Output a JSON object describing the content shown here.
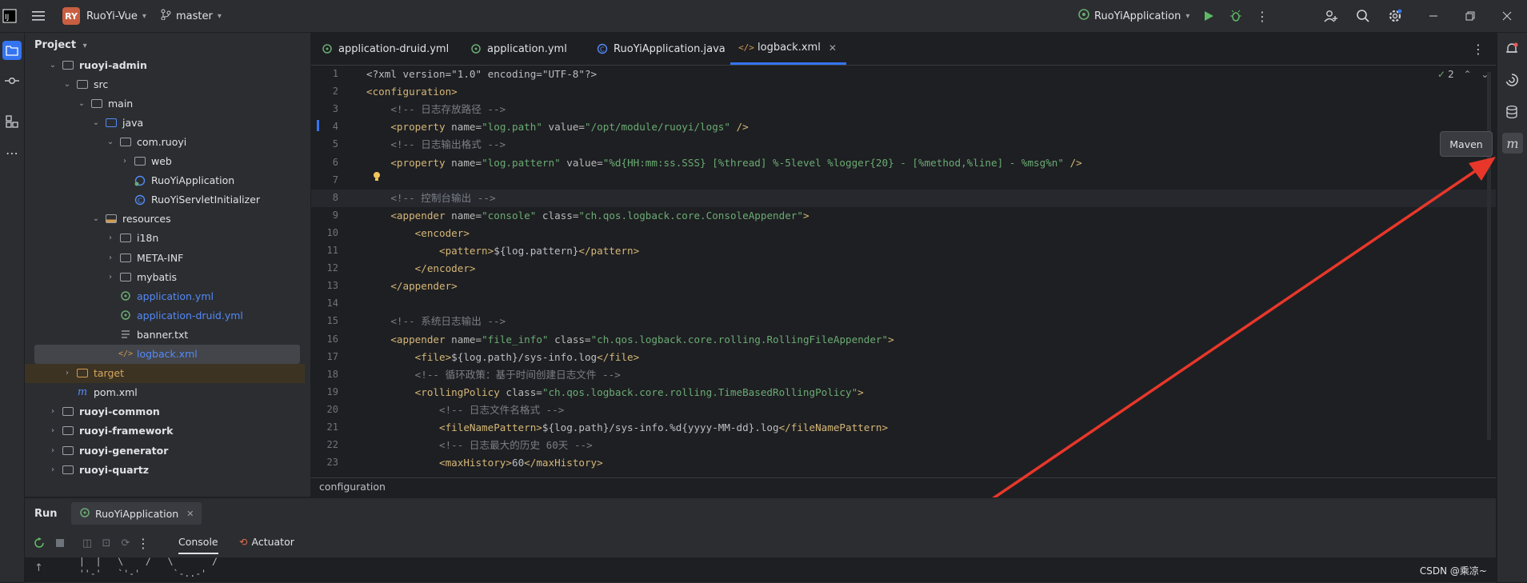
{
  "titlebar": {
    "project_badge": "RY",
    "project_name": "RuoYi-Vue",
    "branch": "master",
    "run_config": "RuoYiApplication",
    "icons": [
      "app-logo-icon",
      "hamburger-menu-icon",
      "branch-icon",
      "run-icon",
      "debug-icon",
      "more-vert-icon",
      "add-user-icon",
      "search-icon",
      "settings-icon",
      "minimize-icon",
      "restore-icon",
      "close-icon"
    ]
  },
  "project_panel": {
    "title": "Project",
    "tree": [
      {
        "label": "ruoyi-admin",
        "bold": true,
        "chevron": "down",
        "icon": "module"
      },
      {
        "label": "src",
        "chevron": "down",
        "icon": "folder"
      },
      {
        "label": "main",
        "chevron": "down",
        "icon": "folder"
      },
      {
        "label": "java",
        "chevron": "down",
        "icon": "folder-blue"
      },
      {
        "label": "com.ruoyi",
        "chevron": "down",
        "icon": "package"
      },
      {
        "label": "web",
        "chevron": "right",
        "icon": "package"
      },
      {
        "label": "RuoYiApplication",
        "icon": "spring-class"
      },
      {
        "label": "RuoYiServletInitializer",
        "icon": "class"
      },
      {
        "label": "resources",
        "chevron": "down",
        "icon": "folder-res"
      },
      {
        "label": "i18n",
        "chevron": "right",
        "icon": "folder"
      },
      {
        "label": "META-INF",
        "chevron": "right",
        "icon": "folder"
      },
      {
        "label": "mybatis",
        "chevron": "right",
        "icon": "folder"
      },
      {
        "label": "application.yml",
        "icon": "yml",
        "color": "blue"
      },
      {
        "label": "application-druid.yml",
        "icon": "yml",
        "color": "blue"
      },
      {
        "label": "banner.txt",
        "icon": "txt"
      },
      {
        "label": "logback.xml",
        "icon": "xml",
        "color": "blue",
        "selected": true
      },
      {
        "label": "target",
        "chevron": "right",
        "icon": "folder-orange",
        "color": "orange",
        "highlight": true
      },
      {
        "label": "pom.xml",
        "icon": "maven"
      },
      {
        "label": "ruoyi-common",
        "bold": true,
        "chevron": "right",
        "icon": "module"
      },
      {
        "label": "ruoyi-framework",
        "bold": true,
        "chevron": "right",
        "icon": "module"
      },
      {
        "label": "ruoyi-generator",
        "bold": true,
        "chevron": "right",
        "icon": "module"
      },
      {
        "label": "ruoyi-quartz",
        "bold": true,
        "chevron": "right",
        "icon": "module"
      }
    ]
  },
  "tabs": [
    {
      "label": "application-druid.yml",
      "icon": "yml"
    },
    {
      "label": "application.yml",
      "icon": "yml"
    },
    {
      "label": "RuoYiApplication.java",
      "icon": "java"
    },
    {
      "label": "logback.xml",
      "icon": "xml",
      "active": true
    }
  ],
  "editor": {
    "inspections_count": "2",
    "current_line": 8,
    "lines": [
      [
        [
          "t-txt",
          "<?xml version=\"1.0\" encoding=\"UTF-8\"?>"
        ]
      ],
      [
        [
          "t-tag",
          "<configuration>"
        ]
      ],
      [
        [
          "t-cm",
          "    <!-- 日志存放路径 -->"
        ]
      ],
      [
        [
          "t-tag",
          "    <property "
        ],
        [
          "t-attr",
          "name="
        ],
        [
          "t-val",
          "\"log.path\" "
        ],
        [
          "t-attr",
          "value="
        ],
        [
          "t-val",
          "\"/opt/module/ruoyi/logs\" "
        ],
        [
          "t-tag",
          "/>"
        ]
      ],
      [
        [
          "t-cm",
          "    <!-- 日志输出格式 -->"
        ]
      ],
      [
        [
          "t-tag",
          "    <property "
        ],
        [
          "t-attr",
          "name="
        ],
        [
          "t-val",
          "\"log.pattern\" "
        ],
        [
          "t-attr",
          "value="
        ],
        [
          "t-val",
          "\"%d{HH:mm:ss.SSS} [%thread] %-5level %logger{20} - [%method,%line] - %msg%n\" "
        ],
        [
          "t-tag",
          "/>"
        ]
      ],
      [
        [
          "t-txt",
          ""
        ]
      ],
      [
        [
          "t-cm",
          "    <!-- 控制台输出 -->"
        ]
      ],
      [
        [
          "t-tag",
          "    <appender "
        ],
        [
          "t-attr",
          "name="
        ],
        [
          "t-val",
          "\"console\" "
        ],
        [
          "t-attr",
          "class="
        ],
        [
          "t-val",
          "\"ch.qos.logback.core.ConsoleAppender\""
        ],
        [
          "t-tag",
          ">"
        ]
      ],
      [
        [
          "t-tag",
          "        <encoder>"
        ]
      ],
      [
        [
          "t-tag",
          "            <pattern>"
        ],
        [
          "t-txt",
          "${log.pattern}"
        ],
        [
          "t-tag",
          "</pattern>"
        ]
      ],
      [
        [
          "t-tag",
          "        </encoder>"
        ]
      ],
      [
        [
          "t-tag",
          "    </appender>"
        ]
      ],
      [
        [
          "t-txt",
          ""
        ]
      ],
      [
        [
          "t-cm",
          "    <!-- 系统日志输出 -->"
        ]
      ],
      [
        [
          "t-tag",
          "    <appender "
        ],
        [
          "t-attr",
          "name="
        ],
        [
          "t-val",
          "\"file_info\" "
        ],
        [
          "t-attr",
          "class="
        ],
        [
          "t-val",
          "\"ch.qos.logback.core.rolling.RollingFileAppender\""
        ],
        [
          "t-tag",
          ">"
        ]
      ],
      [
        [
          "t-tag",
          "        <file>"
        ],
        [
          "t-txt",
          "${log.path}/sys-info.log"
        ],
        [
          "t-tag",
          "</file>"
        ]
      ],
      [
        [
          "t-cm",
          "        <!-- 循环政策：基于时间创建日志文件 -->"
        ]
      ],
      [
        [
          "t-tag",
          "        <rollingPolicy "
        ],
        [
          "t-attr",
          "class="
        ],
        [
          "t-val",
          "\"ch.qos.logback.core.rolling.TimeBasedRollingPolicy\""
        ],
        [
          "t-tag",
          ">"
        ]
      ],
      [
        [
          "t-cm",
          "            <!-- 日志文件名格式 -->"
        ]
      ],
      [
        [
          "t-tag",
          "            <fileNamePattern>"
        ],
        [
          "t-txt",
          "${log.path}/sys-info.%d{yyyy-MM-dd}.log"
        ],
        [
          "t-tag",
          "</fileNamePattern>"
        ]
      ],
      [
        [
          "t-cm",
          "            <!-- 日志最大的历史 60天 -->"
        ]
      ],
      [
        [
          "t-tag",
          "            <maxHistory>"
        ],
        [
          "t-txt",
          "60"
        ],
        [
          "t-tag",
          "</maxHistory>"
        ]
      ]
    ]
  },
  "breadcrumb": "configuration",
  "right_strip": {
    "icons": [
      "notifications-icon",
      "ai-assistant-icon",
      "database-icon",
      "maven-icon"
    ],
    "tooltip": "Maven"
  },
  "run_panel": {
    "title": "Run",
    "config_tab": "RuoYiApplication",
    "subtabs": [
      "Console",
      "Actuator"
    ],
    "console_lines": [
      "  |  |   \\    /   \\       /",
      "  ''-'   `'-'      `-..-'"
    ]
  },
  "watermark": "CSDN @乘凉~",
  "colors": {
    "accent": "#3574f0",
    "arrow": "#e8372a",
    "tag": "#d5b778",
    "string": "#6aab73",
    "comment": "#7a7e85"
  }
}
